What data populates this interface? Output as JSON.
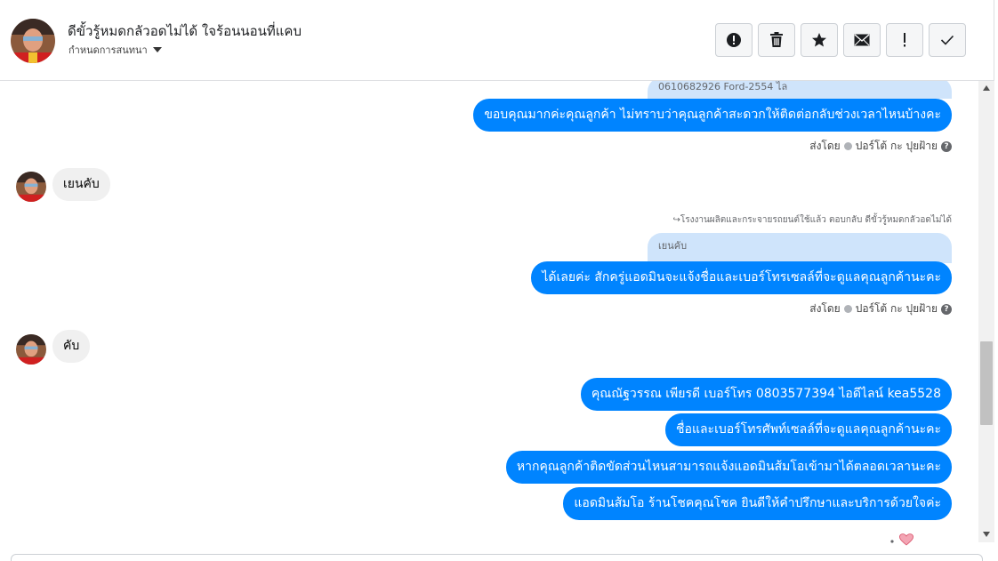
{
  "header": {
    "title": "ดีขั้วรู้หมดกลัวอดไม่ได้ ใจร้อนนอนที่แคบ",
    "assign_label": "กำหนดการสนทนา"
  },
  "toolbar": {
    "buttons": [
      {
        "icon": "exclamation-circle-icon"
      },
      {
        "icon": "trash-icon"
      },
      {
        "icon": "star-icon"
      },
      {
        "icon": "envelope-icon"
      },
      {
        "icon": "exclamation-icon"
      },
      {
        "icon": "checkmark-icon"
      }
    ]
  },
  "messages": {
    "top_quote": "0610682926 Ford-2554 ไล",
    "out1": "ขอบคุณมากค่ะคุณลูกค้า ไม่ทราบว่าคุณลูกค้าสะดวกให้ติดต่อกลับช่วงเวลาไหนบ้างคะ",
    "sent1_prefix": "ส่งโดย",
    "sent1_name": "ปอร์โต้ กะ ปุยฝ้าย",
    "in1": "เยนคับ",
    "reply_note": "↪โรงงานผลิตและกระจายรถยนต์ใช้แล้ว ตอบกลับ ดีขั้วรู้หมดกลัวอดไม่ได้",
    "quote2": "เยนคับ",
    "out2": "ได้เลยค่ะ สักครู่แอดมินจะแจ้งชื่อและเบอร์โทรเซลล์ที่จะดูแลคุณลูกค้านะคะ",
    "sent2_prefix": "ส่งโดย",
    "sent2_name": "ปอร์โต้ กะ ปุยฝ้าย",
    "in2": "คับ",
    "out3": "คุณณัฐวรรณ เพียรดี        เบอร์โทร 0803577394  ไอดีไลน์ kea5528",
    "out4": "ชื่อและเบอร์โทรศัพท์เซลล์ที่จะดูแลคุณลูกค้านะคะ",
    "out5": "หากคุณลูกค้าติดขัดส่วนไหนสามารถแจ้งแอดมินส้มโอเข้ามาได้ตลอดเวลานะคะ",
    "out6": "แอดมินส้มโอ ร้านโชคคุณโชค ยินดีให้คำปรึกษาและบริการด้วยใจค่ะ"
  },
  "colors": {
    "outgoing_bubble": "#0084ff",
    "incoming_bubble": "#f0f0f0",
    "quote_bubble": "#cfe4fb"
  }
}
